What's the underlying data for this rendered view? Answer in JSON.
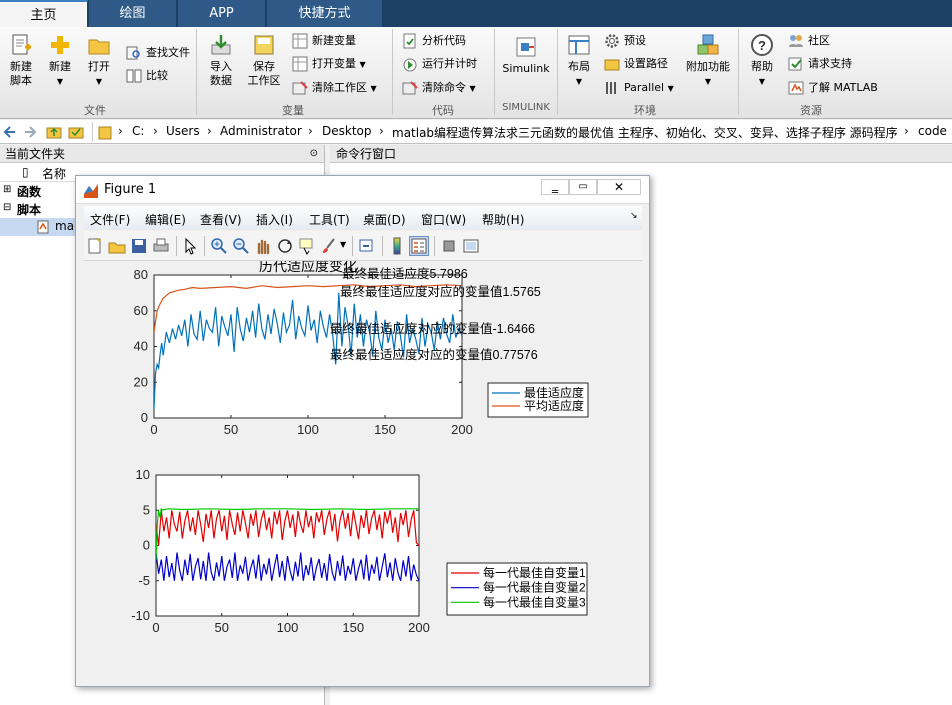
{
  "tabs": [
    "主页",
    "绘图",
    "APP",
    "快捷方式"
  ],
  "ribbon": {
    "new_script": [
      "新建",
      "脚本"
    ],
    "new": "新建",
    "open": "打开",
    "find_files": "查找文件",
    "compare": "比较",
    "group_file": "文件",
    "import": [
      "导入",
      "数据"
    ],
    "save_ws": [
      "保存",
      "工作区"
    ],
    "new_var": "新建变量",
    "open_var": "打开变量",
    "clear_ws": "清除工作区",
    "group_var": "变量",
    "analyze": "分析代码",
    "run_time": "运行并计时",
    "clear_cmd": "清除命令",
    "group_code": "代码",
    "simulink": "Simulink",
    "group_simulink": "SIMULINK",
    "layout": "布局",
    "prefs": "预设",
    "set_path": "设置路径",
    "parallel": "Parallel",
    "addons": "附加功能",
    "group_env": "环境",
    "help": "帮助",
    "community": "社区",
    "support": "请求支持",
    "learn": "了解 MATLAB",
    "group_res": "资源"
  },
  "path": [
    "C:",
    "Users",
    "Administrator",
    "Desktop",
    "matlab编程遗传算法求三元函数的最优值 主程序、初始化、交叉、变异、选择子程序 源码程序",
    "code"
  ],
  "left": {
    "title": "当前文件夹",
    "col_name": "名称",
    "groups": [
      "函数",
      "脚本"
    ],
    "file": "ma"
  },
  "right": {
    "title": "命令行窗口"
  },
  "figure": {
    "title": "Figure 1",
    "menus": [
      "文件(F)",
      "编辑(E)",
      "查看(V)",
      "插入(I)",
      "工具(T)",
      "桌面(D)",
      "窗口(W)",
      "帮助(H)"
    ],
    "toolbar_icons": [
      "new-figure-icon",
      "open-icon",
      "save-icon",
      "print-icon",
      "pointer-icon",
      "zoom-in-icon",
      "zoom-out-icon",
      "pan-icon",
      "rotate-icon",
      "data-cursor-icon",
      "brush-icon",
      "link-icon",
      "colorbar-icon",
      "legend-icon",
      "hide-plot-tools-icon",
      "show-plot-tools-icon"
    ]
  },
  "chart_data": [
    {
      "type": "line",
      "title": "历代适应度变化",
      "xlim": [
        0,
        200
      ],
      "ylim": [
        0,
        80
      ],
      "xticks": [
        0,
        50,
        100,
        150,
        200
      ],
      "yticks": [
        0,
        20,
        40,
        60,
        80
      ],
      "legend": "right-outside",
      "annotations": [
        "最终最佳适应度5.7986",
        "最终最佳适应度对应的变量值1.5765",
        "最终最佳适应度对应的变量值-1.6466",
        "最终最佳适应度对应的变量值0.77576"
      ],
      "series": [
        {
          "name": "最佳适应度",
          "color": "#0072bd",
          "x": [
            0,
            1,
            2,
            3,
            4,
            5,
            6,
            8,
            10,
            12,
            14,
            16,
            18,
            20,
            22,
            24,
            26,
            28,
            30,
            32,
            34,
            36,
            38,
            40,
            42,
            44,
            46,
            48,
            50,
            52,
            54,
            56,
            58,
            60,
            62,
            64,
            66,
            68,
            70,
            72,
            74,
            76,
            78,
            80,
            82,
            84,
            86,
            88,
            90,
            92,
            94,
            96,
            98,
            100,
            102,
            104,
            106,
            108,
            110,
            112,
            114,
            116,
            118,
            120,
            122,
            124,
            126,
            128,
            130,
            132,
            134,
            136,
            138,
            140,
            142,
            144,
            146,
            148,
            150,
            152,
            154,
            156,
            158,
            160,
            162,
            164,
            166,
            168,
            170,
            172,
            174,
            176,
            178,
            180,
            182,
            184,
            186,
            188,
            190,
            192,
            194,
            196,
            198,
            200
          ],
          "y": [
            5,
            25,
            30,
            28,
            36,
            42,
            35,
            48,
            42,
            50,
            44,
            52,
            46,
            55,
            40,
            58,
            47,
            44,
            60,
            43,
            55,
            50,
            48,
            62,
            40,
            57,
            51,
            46,
            58,
            37,
            62,
            50,
            43,
            56,
            48,
            60,
            45,
            64,
            50,
            44,
            58,
            47,
            61,
            53,
            42,
            59,
            48,
            52,
            66,
            44,
            57,
            50,
            46,
            63,
            49,
            55,
            42,
            60,
            51,
            45,
            58,
            47,
            30,
            70,
            40,
            62,
            52,
            35,
            64,
            45,
            58,
            40,
            55,
            48,
            35,
            60,
            45,
            38,
            55,
            42,
            50,
            38,
            54,
            46,
            34,
            58,
            42,
            50,
            44,
            36,
            56,
            40,
            52,
            48,
            38,
            54,
            44,
            56,
            47,
            42,
            58,
            45,
            50,
            46
          ]
        },
        {
          "name": "平均适应度",
          "color": "#d95319",
          "x": [
            0,
            2,
            4,
            6,
            8,
            10,
            12,
            14,
            16,
            20,
            25,
            30,
            40,
            50,
            60,
            70,
            80,
            90,
            100,
            110,
            120,
            130,
            140,
            150,
            160,
            170,
            180,
            190,
            200
          ],
          "y": [
            48,
            60,
            64,
            67,
            68.5,
            70,
            70.5,
            71,
            71.5,
            72,
            73,
            72.5,
            73,
            73.5,
            72.5,
            74,
            73,
            73.5,
            74,
            73.5,
            74,
            74.5,
            73.5,
            74,
            74.5,
            73.5,
            74,
            74.5,
            74
          ]
        }
      ]
    },
    {
      "type": "line",
      "xlim": [
        0,
        200
      ],
      "ylim": [
        -10,
        10
      ],
      "xticks": [
        0,
        50,
        100,
        150,
        200
      ],
      "yticks": [
        -10,
        -5,
        0,
        5,
        10
      ],
      "legend": "right-outside",
      "series": [
        {
          "name": "每一代最佳自变量1",
          "color": "#e00000",
          "x": [
            0,
            2,
            4,
            6,
            8,
            10,
            12,
            14,
            16,
            18,
            20,
            22,
            24,
            26,
            28,
            30,
            32,
            34,
            36,
            38,
            40,
            42,
            44,
            46,
            48,
            50,
            52,
            54,
            56,
            58,
            60,
            62,
            64,
            66,
            68,
            70,
            72,
            74,
            76,
            78,
            80,
            82,
            84,
            86,
            88,
            90,
            92,
            94,
            96,
            98,
            100,
            102,
            104,
            106,
            108,
            110,
            112,
            114,
            116,
            118,
            120,
            122,
            124,
            126,
            128,
            130,
            132,
            134,
            136,
            138,
            140,
            142,
            144,
            146,
            148,
            150,
            152,
            154,
            156,
            158,
            160,
            162,
            164,
            166,
            168,
            170,
            172,
            174,
            176,
            178,
            180,
            182,
            184,
            186,
            188,
            190,
            192,
            194,
            196,
            198,
            200
          ],
          "y": [
            3,
            0,
            5,
            2,
            4,
            1,
            5,
            3,
            2,
            4.8,
            1,
            3.5,
            5,
            2,
            4,
            1.5,
            5,
            3,
            0.5,
            4.5,
            2.5,
            5,
            1,
            3.8,
            5,
            2,
            4.2,
            0.8,
            5,
            3,
            1.5,
            4.7,
            2,
            5,
            3.2,
            1,
            4.5,
            2.8,
            5,
            1.2,
            3.6,
            5,
            2.2,
            4,
            1,
            4.8,
            3,
            5,
            0.8,
            3.5,
            5,
            2.5,
            4.4,
            1.2,
            4.9,
            3,
            1.8,
            5,
            2.6,
            4.2,
            1,
            4.7,
            3.3,
            5,
            1.5,
            3.8,
            5,
            2,
            4.5,
            0.6,
            3.6,
            5,
            2.4,
            4.6,
            1.3,
            5,
            3,
            0.9,
            4.3,
            2.5,
            5,
            1.6,
            3.9,
            5,
            2.2,
            4.4,
            1,
            4.8,
            3.1,
            5,
            1.8,
            4,
            0.5,
            4.6,
            2.9,
            5,
            1.2,
            3.6,
            5,
            0.4,
            0
          ]
        },
        {
          "name": "每一代最佳自变量2",
          "color": "#0000c8",
          "x": [
            0,
            2,
            4,
            6,
            8,
            10,
            12,
            14,
            16,
            18,
            20,
            22,
            24,
            26,
            28,
            30,
            32,
            34,
            36,
            38,
            40,
            42,
            44,
            46,
            48,
            50,
            52,
            54,
            56,
            58,
            60,
            62,
            64,
            66,
            68,
            70,
            72,
            74,
            76,
            78,
            80,
            82,
            84,
            86,
            88,
            90,
            92,
            94,
            96,
            98,
            100,
            102,
            104,
            106,
            108,
            110,
            112,
            114,
            116,
            118,
            120,
            122,
            124,
            126,
            128,
            130,
            132,
            134,
            136,
            138,
            140,
            142,
            144,
            146,
            148,
            150,
            152,
            154,
            156,
            158,
            160,
            162,
            164,
            166,
            168,
            170,
            172,
            174,
            176,
            178,
            180,
            182,
            184,
            186,
            188,
            190,
            192,
            194,
            196,
            198,
            200
          ],
          "y": [
            -1,
            -4,
            -2,
            -5,
            -1.5,
            -4.5,
            -2.5,
            -5,
            -1,
            -3.5,
            -5,
            -2,
            -4.2,
            -1.2,
            -5,
            -3,
            -1.8,
            -4.8,
            -2.2,
            -5,
            -1,
            -3.8,
            -5,
            -2.4,
            -4.4,
            -1.5,
            -5,
            -3,
            -2,
            -4.6,
            -1,
            -5,
            -2.8,
            -4,
            -1.6,
            -5,
            -3.2,
            -2,
            -4.7,
            -1.3,
            -5,
            -2.6,
            -4.1,
            -1.8,
            -5,
            -3,
            -1.2,
            -4.5,
            -2.2,
            -5,
            -1.5,
            -3.6,
            -5,
            -2.3,
            -4.4,
            -1,
            -5,
            -2.8,
            -4.2,
            -1.7,
            -5,
            -3.1,
            -1.9,
            -4.6,
            -2.5,
            -5,
            -1.2,
            -3.8,
            -5,
            -2.2,
            -4.3,
            -1.4,
            -5,
            -2.9,
            -4.1,
            -1.8,
            -5,
            -3.3,
            -2,
            -4.8,
            -1.3,
            -5,
            -2.7,
            -4,
            -1.6,
            -5,
            -3,
            -1.1,
            -4.5,
            -2.4,
            -5,
            -1.8,
            -3.9,
            -5,
            -2.1,
            -4.4,
            -1.5,
            -5,
            -2.7,
            -4.2,
            -5
          ]
        },
        {
          "name": "每一代最佳自变量3",
          "color": "#00c800",
          "x": [
            0,
            1,
            2,
            3,
            4,
            5,
            6,
            10,
            20,
            40,
            60,
            80,
            100,
            120,
            140,
            160,
            180,
            200
          ],
          "y": [
            -2,
            3,
            5,
            4,
            5.2,
            5,
            5.1,
            5.2,
            5.1,
            5.2,
            5.1,
            5.2,
            5.2,
            5.1,
            5.2,
            5.1,
            5.2,
            5.2
          ]
        }
      ]
    }
  ]
}
